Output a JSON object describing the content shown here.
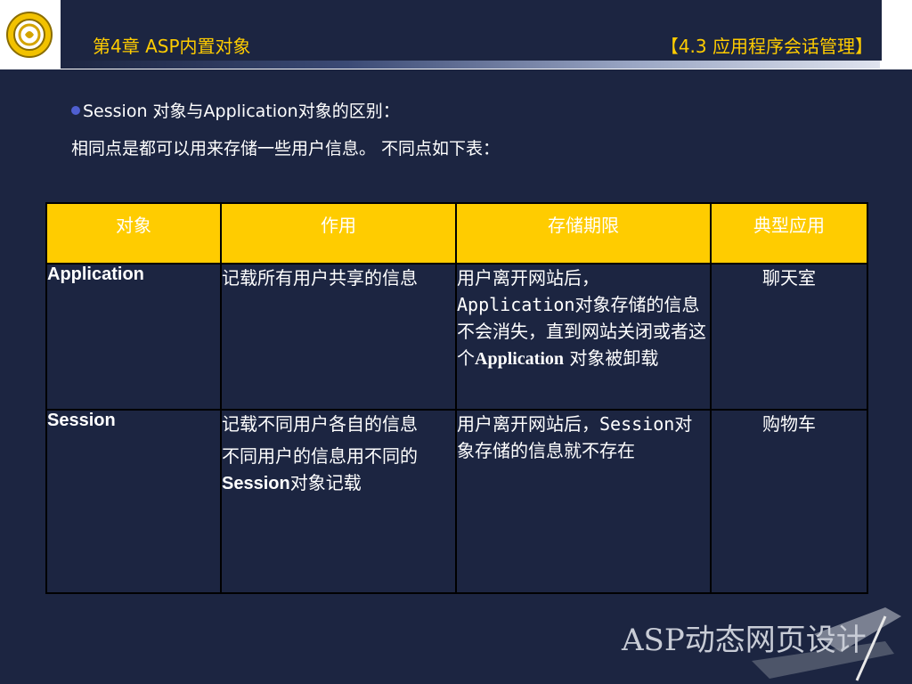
{
  "header": {
    "chapter_title": "第4章  ASP内置对象",
    "section_title": "【4.3 应用程序会话管理】"
  },
  "intro": {
    "bullet_text": "Session 对象与Application对象的区别：",
    "line2": "相同点是都可以用来存储一些用户信息。 不同点如下表："
  },
  "table": {
    "headers": [
      "对象",
      "作用",
      "存储期限",
      "典型应用"
    ],
    "rows": [
      {
        "object": "Application",
        "purpose": [
          "记载所有用户共享的信息"
        ],
        "storage_prefix": "用户离开网站后，",
        "storage_mono": "Application",
        "storage_middle": "对象存储的信息不会消失，直到网站关闭或者这个",
        "storage_bold": "Application",
        "storage_suffix": " 对象被卸载",
        "usage": "聊天室"
      },
      {
        "object": "Session",
        "purpose_1": "记载不同用户各自的信息",
        "purpose_2_pre": "不同用户的信息用不同的",
        "purpose_2_bold": "Session",
        "purpose_2_post": "对象记载",
        "storage_prefix": "用户离开网站后，",
        "storage_mono": "Session",
        "storage_suffix": "对象存储的信息就不存在",
        "usage": "购物车"
      }
    ]
  },
  "watermark_text": "ASP动态网页设计",
  "colors": {
    "background": "#1c2541",
    "accent": "#ffcc00",
    "bullet": "#4f5fd0"
  }
}
